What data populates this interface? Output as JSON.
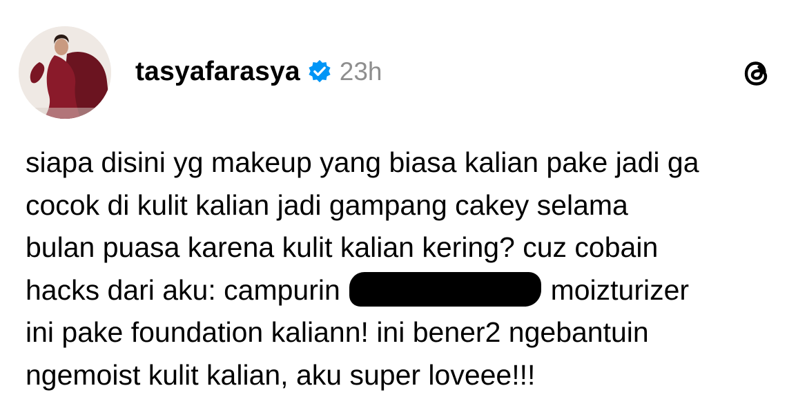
{
  "post": {
    "username": "tasyafarasya",
    "verified": true,
    "timestamp": "23h",
    "text_lines": {
      "l1": "siapa disini yg makeup yang biasa kalian pake jadi ga",
      "l2": "cocok di kulit kalian jadi gampang cakey selama",
      "l3": "bulan puasa karena kulit kalian kering? cuz cobain",
      "l4_before": "hacks dari aku: campurin",
      "l4_after": "moizturizer",
      "l5": "ini pake foundation kaliann! ini bener2 ngebantuin",
      "l6": "ngemoist kulit kalian, aku super loveee!!!"
    }
  },
  "icons": {
    "verified": "verified-badge-icon",
    "brand": "threads-logo-icon",
    "avatar": "profile-photo"
  },
  "colors": {
    "verified_blue": "#0095f6",
    "timestamp_gray": "#8e8e8e",
    "text": "#000000",
    "background": "#ffffff"
  }
}
